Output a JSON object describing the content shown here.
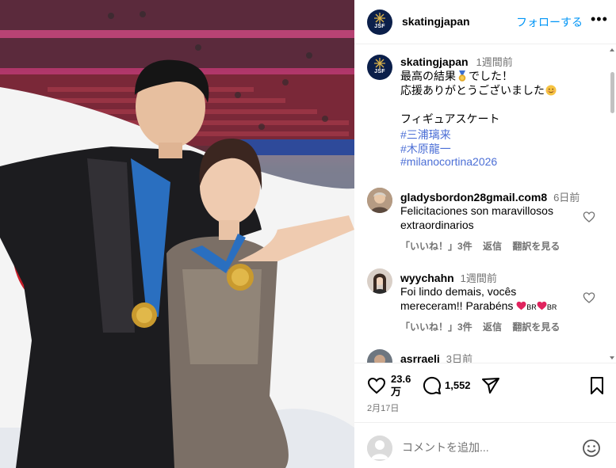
{
  "post": {
    "account": "skatingjapan",
    "account_logo_text": "JSF",
    "follow_label": "フォローする",
    "more_label": "•••"
  },
  "caption": {
    "username": "skatingjapan",
    "time": "1週間前",
    "line1_a": "最高の結果",
    "line1_b": "でした！",
    "line2": "応援ありがとうございました",
    "line3": "フィギュアスケート",
    "hashtags": [
      "#三浦璃来",
      "#木原龍一",
      "#milanocortina2026"
    ]
  },
  "comments": [
    {
      "username": "gladysbordon28gmail.com8",
      "time": "6日前",
      "text_line1": "Felicitaciones son maravillosos",
      "text_line2": "extraordinarios",
      "likes": "「いいね！」3件",
      "reply": "返信",
      "translate": "翻訳を見る"
    },
    {
      "username": "wyychahn",
      "time": "1週間前",
      "text_line1": "Foi lindo demais, vocês",
      "text_line2": "mereceram!! Parabéns",
      "br1": "BR",
      "br2": "BR",
      "likes": "「いいね！」3件",
      "reply": "返信",
      "translate": "翻訳を見る"
    },
    {
      "username": "asrraeli",
      "time": "3日前"
    }
  ],
  "actions": {
    "likes_count": "23.6万",
    "likes_count_line1": "23.6",
    "likes_count_line2": "万",
    "comments_count": "1,552",
    "date": "2月17日"
  },
  "comment_box": {
    "placeholder": "コメントを追加..."
  },
  "colors": {
    "accent": "#0095f6",
    "hashtag": "#4c6fd6",
    "like_red": "#e0245e",
    "logo_navy": "#0b1f4a"
  },
  "icons": [
    "heart-icon",
    "comment-icon",
    "share-icon",
    "bookmark-icon",
    "emoji-icon",
    "more-icon",
    "medal-icon"
  ]
}
